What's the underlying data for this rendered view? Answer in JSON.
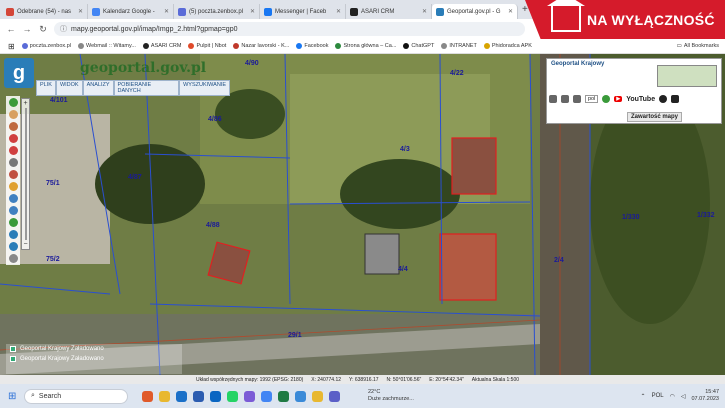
{
  "browser": {
    "tabs": [
      {
        "label": "Odebrane (54) - nas",
        "color": "#d44638",
        "active": false
      },
      {
        "label": "Kalendarz Google -",
        "color": "#4285f4",
        "active": false
      },
      {
        "label": "(5) poczta.zenbox.pl",
        "color": "#5a6bd8",
        "active": false
      },
      {
        "label": "Messenger | Faceb",
        "color": "#1877f2",
        "active": false
      },
      {
        "label": "ASARI CRM",
        "color": "#222222",
        "active": false
      },
      {
        "label": "Geoportal.gov.pl - G",
        "color": "#2a7db8",
        "active": true
      }
    ],
    "new_tab": "+",
    "url": "mapy.geoportal.gov.pl/imap/Imgp_2.html?gpmap=gp0",
    "bookmarks": [
      {
        "label": "poczta.zenbox.pl",
        "color": "#5a6bd8"
      },
      {
        "label": "Webmail :: Witamy...",
        "color": "#888888"
      },
      {
        "label": "ASARI CRM",
        "color": "#222222"
      },
      {
        "label": "Pulpit | Nbot",
        "color": "#e04a2a"
      },
      {
        "label": "Nazar lavorski - K...",
        "color": "#c0392b"
      },
      {
        "label": "Facebook",
        "color": "#1877f2"
      },
      {
        "label": "Strona główna – Ca...",
        "color": "#2c8a3e"
      },
      {
        "label": "ChatGPT",
        "color": "#111111"
      },
      {
        "label": "INTRANET",
        "color": "#888888"
      },
      {
        "label": "Phidoradca APK",
        "color": "#d8a400"
      }
    ],
    "all_bookmarks": "All Bookmarks"
  },
  "promo": {
    "text": "NA WYŁĄCZNOŚĆ"
  },
  "geoportal": {
    "logo_letter": "g",
    "title": "geoportal.gov.pl",
    "menu": [
      "PLIK",
      "WIDOK",
      "ANALIZY",
      "POBIERANIE DANYCH",
      "WYSZUKIWANIE"
    ],
    "panel_title": "Geoportal Krajowy",
    "lang": "pol",
    "youtube": "YouTube",
    "content_button": "Zawartość mapy",
    "layers": [
      {
        "name": "Geoportal Krajowy  Załadowano"
      },
      {
        "name": "Geoportal Krajowy  Załadowano"
      }
    ],
    "parcels": [
      "4/90",
      "4/101",
      "4/86",
      "4/22",
      "4/3",
      "75/1",
      "4/87",
      "4/88",
      "75/2",
      "4/4",
      "1/330",
      "1/332",
      "2/4",
      "29/1"
    ],
    "status": {
      "system": "Układ współrzędnych mapy: 1992 (EPSG: 2180)",
      "x": "X: 240774.12",
      "y": "Y: 638916.17",
      "n": "N: 50°01'06.56\"",
      "e": "E: 20°54'42.34\"",
      "scale": "Aktualna Skala 1:500"
    }
  },
  "taskbar": {
    "search_placeholder": "Search",
    "weather_temp": "22°C",
    "weather_text": "Duże zachmurze...",
    "lang": "POL",
    "time": "15:47",
    "date": "07.07.2023"
  },
  "colors": {
    "accent": "#2a7db8",
    "promo": "#d51b2b",
    "parcel_line": "#2a4fd0",
    "building": "#e02020"
  }
}
